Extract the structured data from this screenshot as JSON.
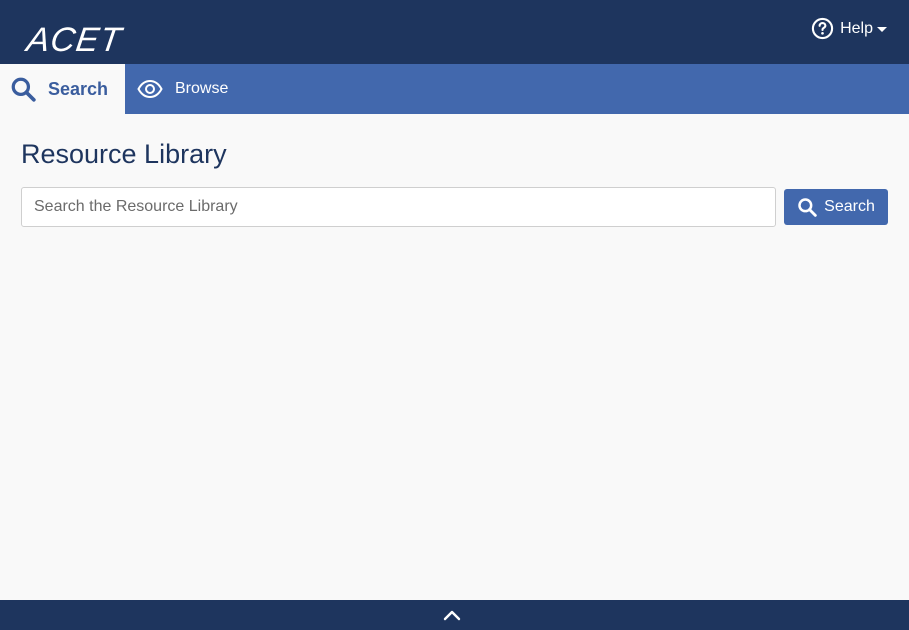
{
  "header": {
    "logo_text": "ACET",
    "help_label": "Help",
    "help_icon": "question-circle-icon",
    "help_caret_icon": "caret-down-icon"
  },
  "tabs": [
    {
      "label": "Search",
      "icon": "search-icon",
      "active": true
    },
    {
      "label": "Browse",
      "icon": "eye-icon",
      "active": false
    }
  ],
  "main": {
    "title": "Resource Library",
    "search": {
      "placeholder": "Search the Resource Library",
      "value": "",
      "button_label": "Search",
      "button_icon": "search-icon"
    }
  },
  "footer": {
    "toggle_icon": "chevron-up-icon"
  },
  "colors": {
    "header_bg": "#1e355e",
    "tabbar_bg": "#4268ad",
    "page_bg": "#f9f9f9",
    "accent": "#4268ad",
    "title": "#1e355e"
  }
}
